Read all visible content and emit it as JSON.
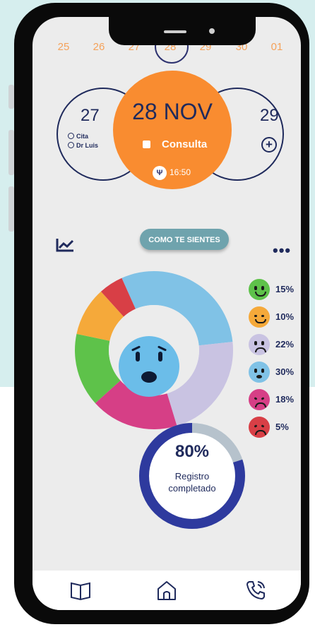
{
  "colors": {
    "page_background": "#d6eeee",
    "accent_orange": "#f98c30",
    "navy": "#1f2a5c",
    "button_teal": "#6fa3ad",
    "progress_ring": "#2e3a9e",
    "progress_track": "#b6c2cc"
  },
  "date_strip": [
    "25",
    "26",
    "27",
    "28",
    "29",
    "30",
    "01"
  ],
  "calendar": {
    "prev_day": {
      "number": "27",
      "items": [
        "Cita",
        "Dr Luis"
      ]
    },
    "selected": {
      "date": "28 NOV",
      "event": "Consulta",
      "time": "16:50",
      "icon": "stethoscope-icon"
    },
    "next_day": {
      "number": "29",
      "icon": "plus-icon"
    }
  },
  "mood_section": {
    "button_label": "COMO TE SIENTES",
    "left_icon": "trend-chart-icon",
    "right_icon": "more-icon",
    "center_face": "anxious-face"
  },
  "chart_data": {
    "type": "pie",
    "categories": [
      "happy",
      "smiling",
      "sad",
      "anxious",
      "upset",
      "angry"
    ],
    "values": [
      15,
      10,
      22,
      30,
      18,
      5
    ],
    "colors": [
      "#5ec24a",
      "#f5a93a",
      "#c9c3e2",
      "#80c2e6",
      "#d63f86",
      "#d83f46"
    ],
    "labels": [
      "15%",
      "10%",
      "22%",
      "30%",
      "18%",
      "5%"
    ]
  },
  "progress": {
    "percent_label": "80%",
    "fraction": 0.8,
    "label_line1": "Registro",
    "label_line2": "completado"
  },
  "bottom_nav": [
    "book-icon",
    "home-icon",
    "phone-call-icon"
  ]
}
